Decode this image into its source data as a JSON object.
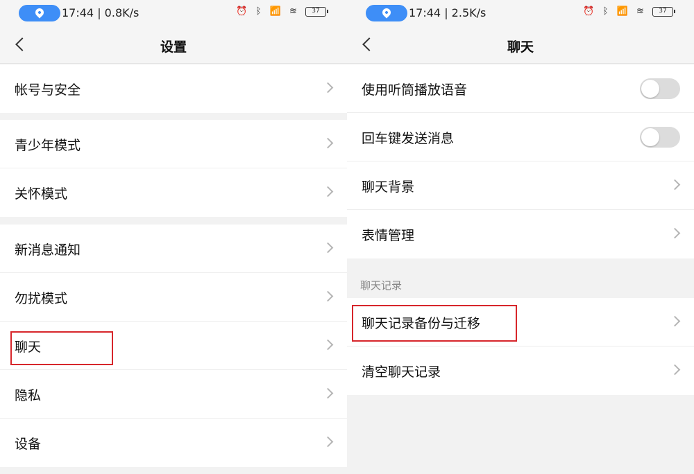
{
  "colors": {
    "highlight": "#d7262b",
    "location_pill": "#3e8ef7",
    "toggle_off": "#dcdcdc"
  },
  "left": {
    "status": {
      "time_speed": "17:44 | 0.8K/s",
      "battery": "37",
      "icons": [
        "location-icon",
        "alarm-icon",
        "bluetooth-icon",
        "hd-signal-icon",
        "wifi-icon",
        "battery-icon"
      ]
    },
    "nav": {
      "title": "设置"
    },
    "groups": [
      {
        "items": [
          "帐号与安全"
        ]
      },
      {
        "items": [
          "青少年模式",
          "关怀模式"
        ]
      },
      {
        "items": [
          "新消息通知",
          "勿扰模式",
          "聊天",
          "隐私",
          "设备"
        ]
      }
    ]
  },
  "right": {
    "status": {
      "time_speed": "17:44 | 2.5K/s",
      "battery": "37"
    },
    "nav": {
      "title": "聊天"
    },
    "toggles": [
      {
        "label": "使用听筒播放语音",
        "on": false
      },
      {
        "label": "回车键发送消息",
        "on": false
      }
    ],
    "links": [
      "聊天背景",
      "表情管理"
    ],
    "section_label": "聊天记录",
    "record_items": [
      "聊天记录备份与迁移",
      "清空聊天记录"
    ]
  }
}
